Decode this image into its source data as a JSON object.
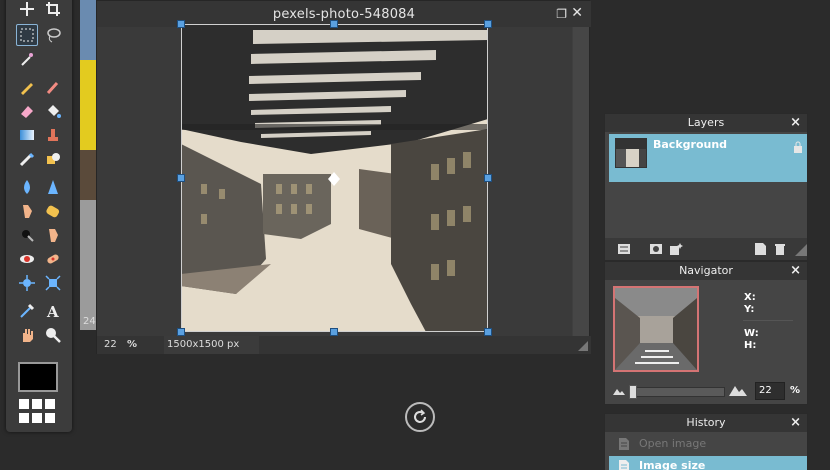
{
  "document": {
    "title": "pexels-photo-548084",
    "zoom_value": "22",
    "zoom_unit": "%",
    "image_size": "1500x1500 px"
  },
  "background_doc": {
    "zoom_fragment": "24"
  },
  "tools": [
    {
      "name": "move-icon"
    },
    {
      "name": "crop-icon"
    },
    {
      "name": "marquee-select-icon",
      "selected": true
    },
    {
      "name": "lasso-icon"
    },
    {
      "name": "magic-wand-icon"
    },
    {
      "name": "pencil-icon"
    },
    {
      "name": "brush-icon"
    },
    {
      "name": "eraser-icon"
    },
    {
      "name": "paint-bucket-icon"
    },
    {
      "name": "gradient-icon"
    },
    {
      "name": "clone-stamp-icon"
    },
    {
      "name": "color-replace-icon"
    },
    {
      "name": "drawing-icon"
    },
    {
      "name": "blur-icon"
    },
    {
      "name": "sharpen-icon"
    },
    {
      "name": "smudge-icon"
    },
    {
      "name": "sponge-icon"
    },
    {
      "name": "dodge-icon"
    },
    {
      "name": "burn-icon"
    },
    {
      "name": "red-eye-icon"
    },
    {
      "name": "spot-heal-icon"
    },
    {
      "name": "bloat-icon"
    },
    {
      "name": "pinch-icon"
    },
    {
      "name": "color-picker-icon"
    },
    {
      "name": "type-icon"
    },
    {
      "name": "hand-icon"
    },
    {
      "name": "zoom-icon"
    }
  ],
  "colors": {
    "primary_swatch": "#000000",
    "accent": "#79bbd1",
    "handle": "#5aa0e0"
  },
  "layers": {
    "title": "Layers",
    "close": "×",
    "items": [
      {
        "name": "Background",
        "locked": true
      }
    ]
  },
  "navigator": {
    "title": "Navigator",
    "close": "×",
    "x_label": "X:",
    "y_label": "Y:",
    "w_label": "W:",
    "h_label": "H:",
    "zoom_value": "22",
    "zoom_unit": "%"
  },
  "history": {
    "title": "History",
    "close": "×",
    "items": [
      {
        "label": "Open image",
        "state": "dim"
      },
      {
        "label": "Image size",
        "state": "active"
      }
    ]
  }
}
